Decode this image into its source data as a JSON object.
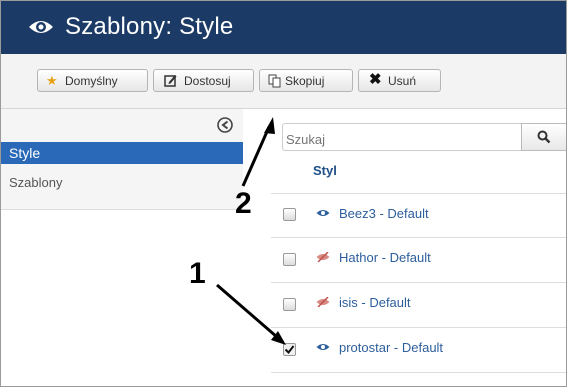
{
  "header": {
    "title": "Szablony: Style",
    "icon": "eye-icon",
    "background": "#1b3b66"
  },
  "toolbar": {
    "buttons": [
      {
        "label": "Domyślny",
        "icon": "star-icon"
      },
      {
        "label": "Dostosuj",
        "icon": "edit-icon"
      },
      {
        "label": "Skopiuj",
        "icon": "copy-icon"
      },
      {
        "label": "Usuń",
        "icon": "delete-x-icon"
      }
    ]
  },
  "sidebar": {
    "items": [
      {
        "label": "Style",
        "active": true
      },
      {
        "label": "Szablony",
        "active": false
      }
    ],
    "accent": "#2a69b8"
  },
  "search": {
    "placeholder": "Szukaj"
  },
  "table": {
    "column_header": "Styl",
    "rows": [
      {
        "label": "Beez3 - Default",
        "checked": false,
        "default": true
      },
      {
        "label": "Hathor - Default",
        "checked": false,
        "default": false
      },
      {
        "label": "isis - Default",
        "checked": false,
        "default": false
      },
      {
        "label": "protostar - Default",
        "checked": true,
        "default": true
      }
    ]
  },
  "annotations": {
    "label_1": "1",
    "label_2": "2"
  }
}
